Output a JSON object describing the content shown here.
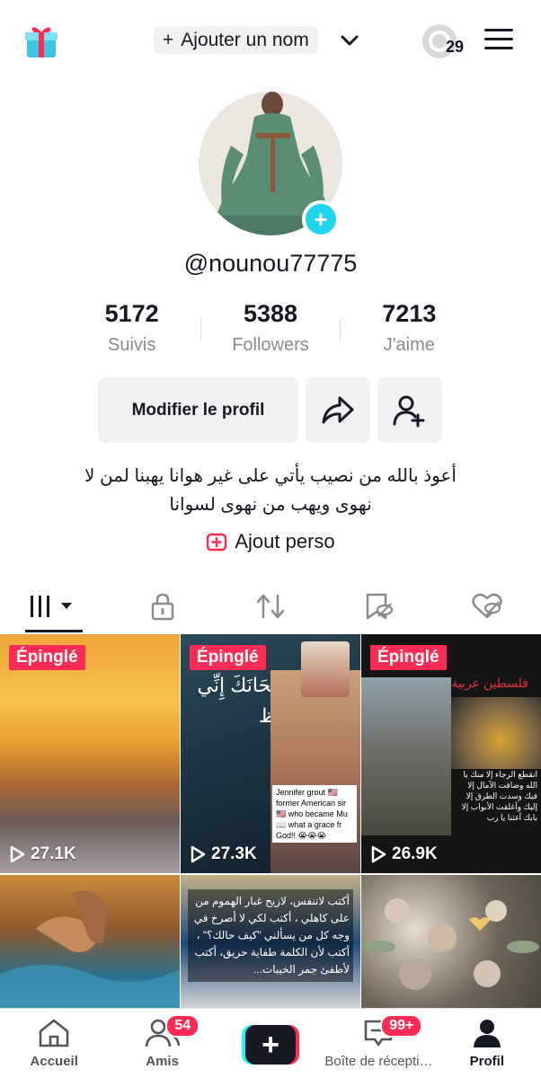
{
  "header": {
    "add_name_plus": "+",
    "add_name_label": "Ajouter un nom",
    "story_count": "29"
  },
  "profile": {
    "avatar_plus": "+",
    "handle": "@nounou77775",
    "stats": [
      {
        "value": "5172",
        "label": "Suivis"
      },
      {
        "value": "5388",
        "label": "Followers"
      },
      {
        "value": "7213",
        "label": "J'aime"
      }
    ],
    "edit_button": "Modifier le profil",
    "bio_line1": "أعوذ بالله من نصيب يأتي على غير هوانا يهبنا لمن لا",
    "bio_line2": "نهوى ويهب من نهوى لسوانا",
    "add_link": "Ajout perso"
  },
  "tabs": [
    {
      "icon": "grid-icon",
      "active": true
    },
    {
      "icon": "lock-icon",
      "active": false
    },
    {
      "icon": "repost-icon",
      "active": false
    },
    {
      "icon": "saved-icon",
      "active": false
    },
    {
      "icon": "liked-icon",
      "active": false
    }
  ],
  "videos": [
    {
      "pinned": "Épinglé",
      "views": "27.1K"
    },
    {
      "pinned": "Épinglé",
      "views": "27.3K",
      "overlay_arabic": "لا إِلَهَ إِلاَّ سُبْحَانَكَ إِنِّي كُنتُ مِنَ الظ",
      "caption": "Jennifer grout 🇺🇸 former American sir 🇺🇸 who became Mu 📖 what a grace fr God!! 😭😭😭"
    },
    {
      "pinned": "Épinglé",
      "views": "26.9K",
      "title": "فلسطين عربية",
      "overlay_text": "انقطع الرجاء إلا منك يا الله وضاقت الآمال إلا فيك وسدت الطرق إلا إليك وأغلقت الأبواب إلا بابك أغثنا يا رب"
    },
    {},
    {
      "overlay_text": "أكتب لاتنفس، لازيح غبار الهموم من على كاهلي ، أكتب لكي لا أصرخ في وجه كل من يسألني \"كيف حالك؟\" ، أكتب لأن الكلمة طفاية حريق، أكتب لأطفئ جمر الخيبات..."
    },
    {}
  ],
  "bottom_nav": [
    {
      "label": "Accueil"
    },
    {
      "label": "Amis",
      "badge": "54"
    },
    {
      "label": "+"
    },
    {
      "label": "Boîte de récepti…",
      "badge": "99+"
    },
    {
      "label": "Profil"
    }
  ],
  "colors": {
    "accent": "#fe2c55",
    "cyan": "#20d5ec",
    "text": "#161823",
    "muted": "#8a8b91",
    "button_bg": "#f1f1f2"
  }
}
